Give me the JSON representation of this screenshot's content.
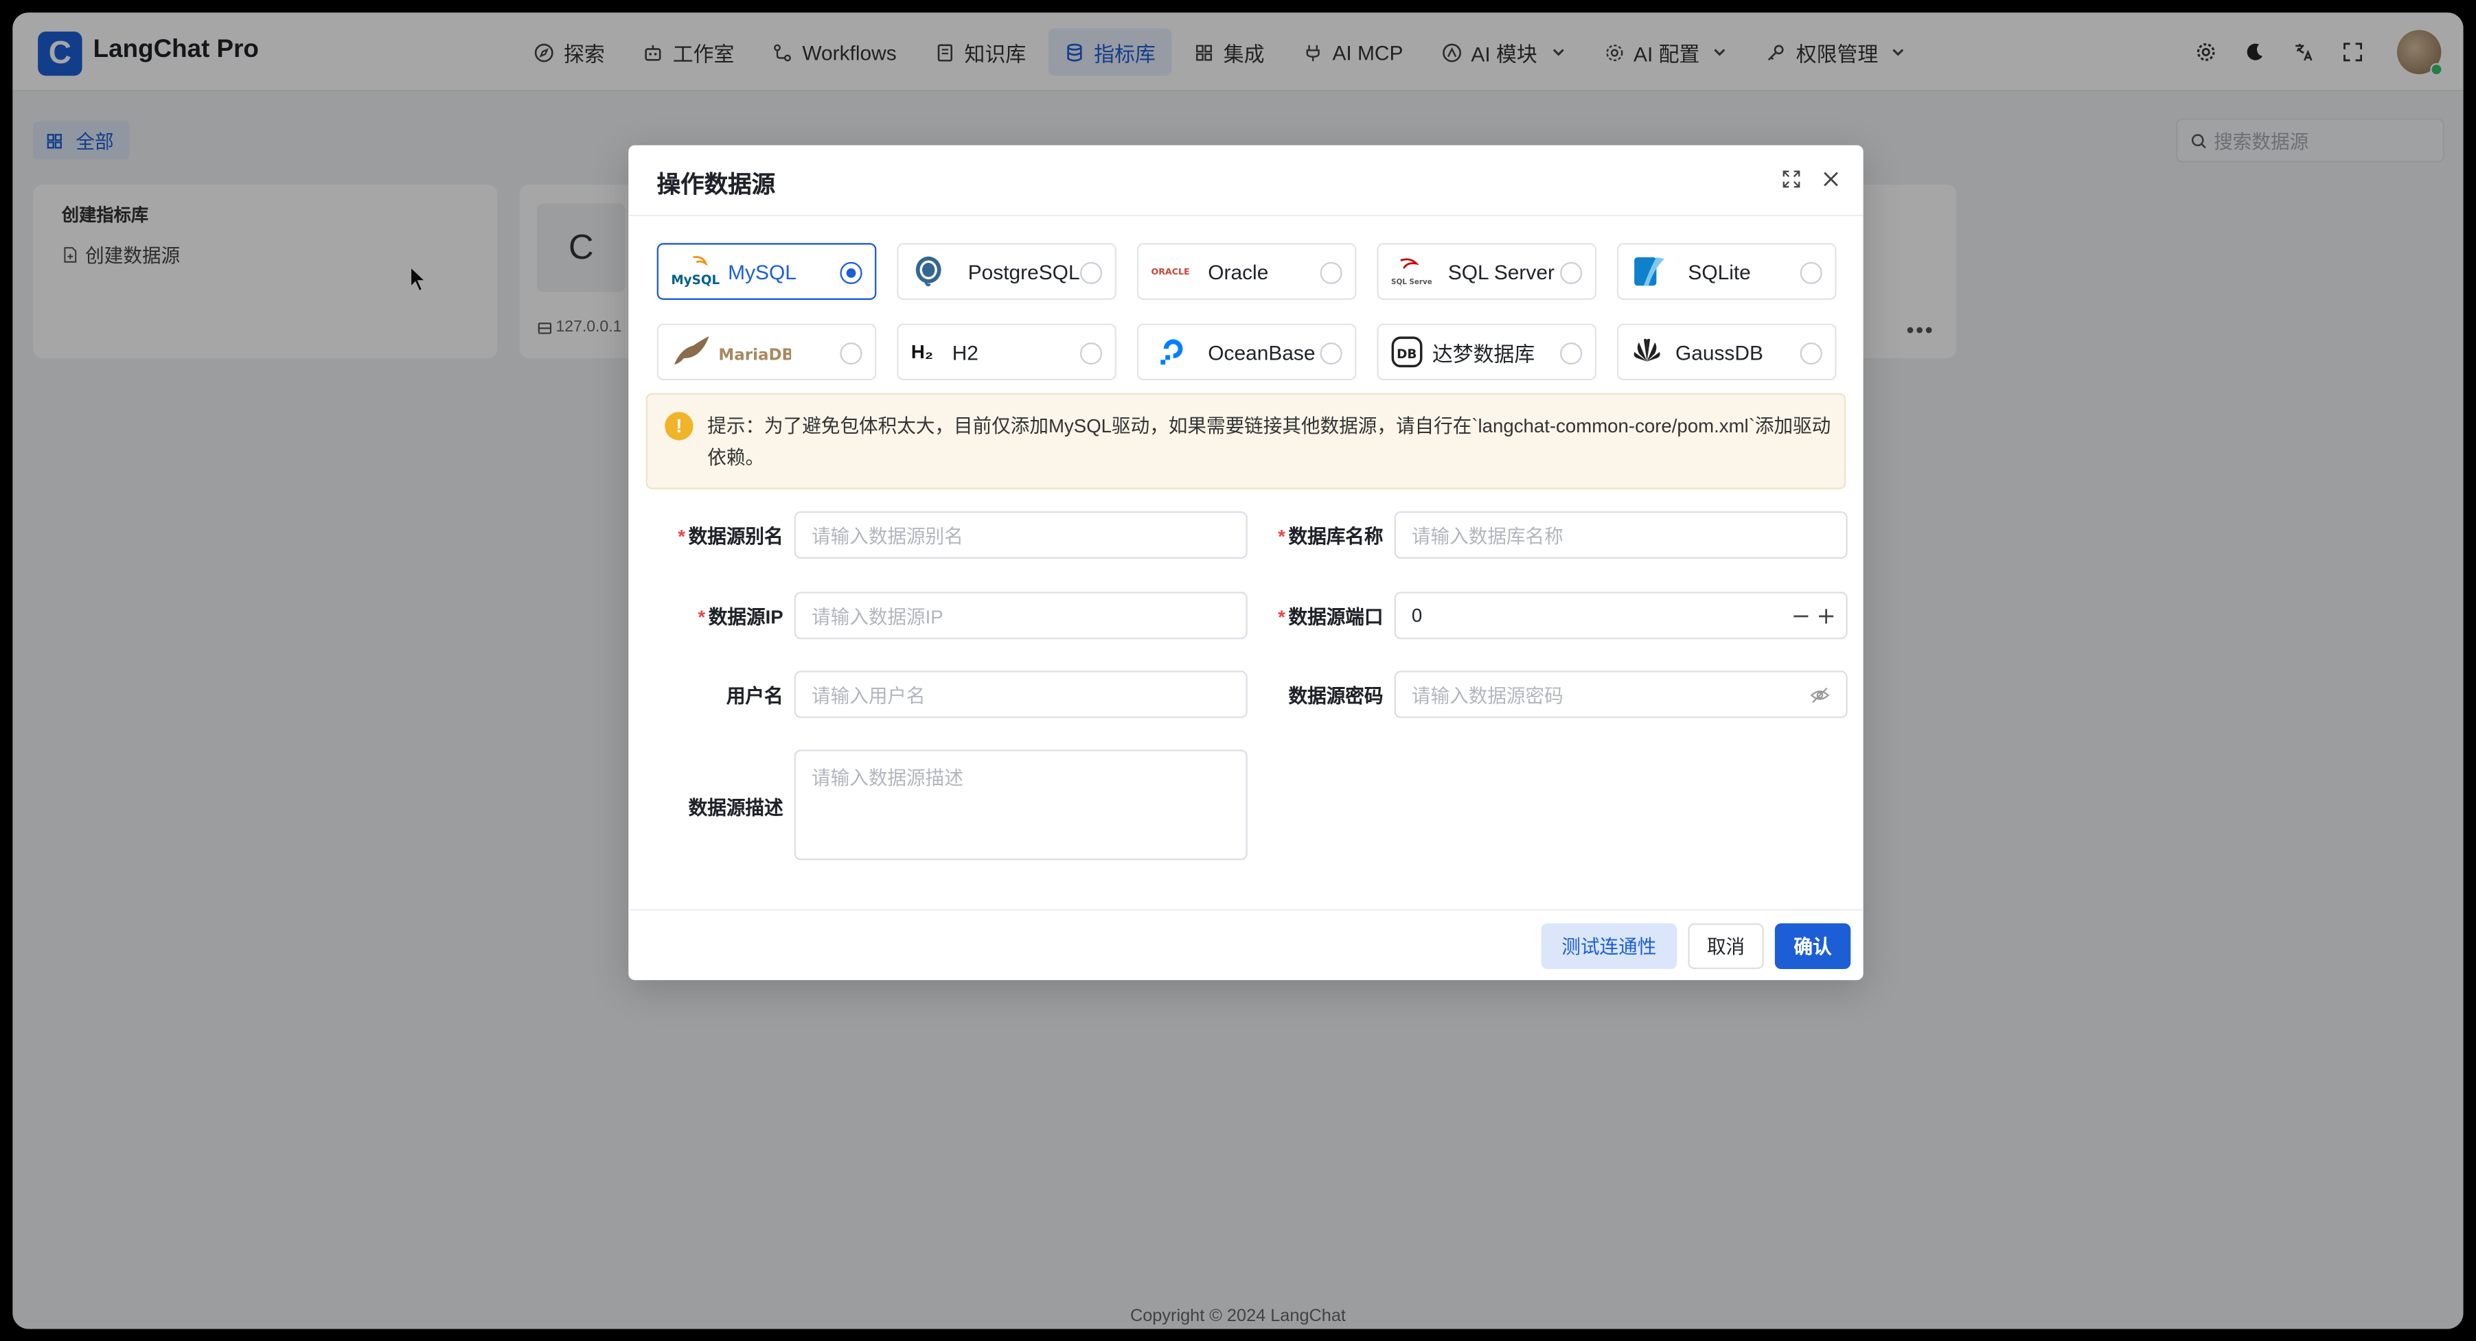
{
  "app": {
    "logo_letter": "C",
    "title": "LangChat Pro"
  },
  "nav": {
    "items": [
      {
        "label": "探索",
        "icon": "compass-icon"
      },
      {
        "label": "工作室",
        "icon": "robot-icon"
      },
      {
        "label": "Workflows",
        "icon": "workflow-icon"
      },
      {
        "label": "知识库",
        "icon": "book-icon"
      },
      {
        "label": "指标库",
        "icon": "database-icon",
        "active": true
      },
      {
        "label": "集成",
        "icon": "grid-icon"
      },
      {
        "label": "AI MCP",
        "icon": "plug-icon"
      },
      {
        "label": "AI 模块",
        "icon": "module-icon",
        "dropdown": true
      },
      {
        "label": "AI 配置",
        "icon": "gear-icon",
        "dropdown": true
      },
      {
        "label": "权限管理",
        "icon": "key-icon",
        "dropdown": true
      }
    ]
  },
  "page": {
    "all_tab": "全部",
    "search_placeholder": "搜索数据源",
    "create_card": {
      "title": "创建指标库",
      "link": "创建数据源"
    },
    "ds_card": {
      "badge": "C",
      "ip": "127.0.0.1",
      "more": "•••"
    },
    "footer": "Copyright © 2024 LangChat"
  },
  "modal": {
    "title": "操作数据源",
    "db_types": [
      {
        "label": "MySQL",
        "selected": true
      },
      {
        "label": "PostgreSQL"
      },
      {
        "label": "Oracle"
      },
      {
        "label": "SQL Server"
      },
      {
        "label": "SQLite"
      },
      {
        "label": ""
      },
      {
        "label": "H2"
      },
      {
        "label": "OceanBase"
      },
      {
        "label": "达梦数据库"
      },
      {
        "label": "GaussDB"
      }
    ],
    "logo_texts": {
      "mysql": "MySQL",
      "mariadb": "MariaDB",
      "h2": "H₂",
      "oracle": "ORACLE",
      "dm": "DB",
      "sqlserver": "SQL Server"
    },
    "alert": "提示：为了避免包体积太大，目前仅添加MySQL驱动，如果需要链接其他数据源，请自行在`langchat-common-core/pom.xml`添加驱动依赖。",
    "form": {
      "alias_label": "数据源别名",
      "alias_placeholder": "请输入数据源别名",
      "dbname_label": "数据库名称",
      "dbname_placeholder": "请输入数据库名称",
      "ip_label": "数据源IP",
      "ip_placeholder": "请输入数据源IP",
      "port_label": "数据源端口",
      "port_value": "0",
      "user_label": "用户名",
      "user_placeholder": "请输入用户名",
      "pwd_label": "数据源密码",
      "pwd_placeholder": "请输入数据源密码",
      "desc_label": "数据源描述",
      "desc_placeholder": "请输入数据源描述",
      "required_mark": "*"
    },
    "buttons": {
      "test": "测试连通性",
      "cancel": "取消",
      "ok": "确认"
    }
  }
}
